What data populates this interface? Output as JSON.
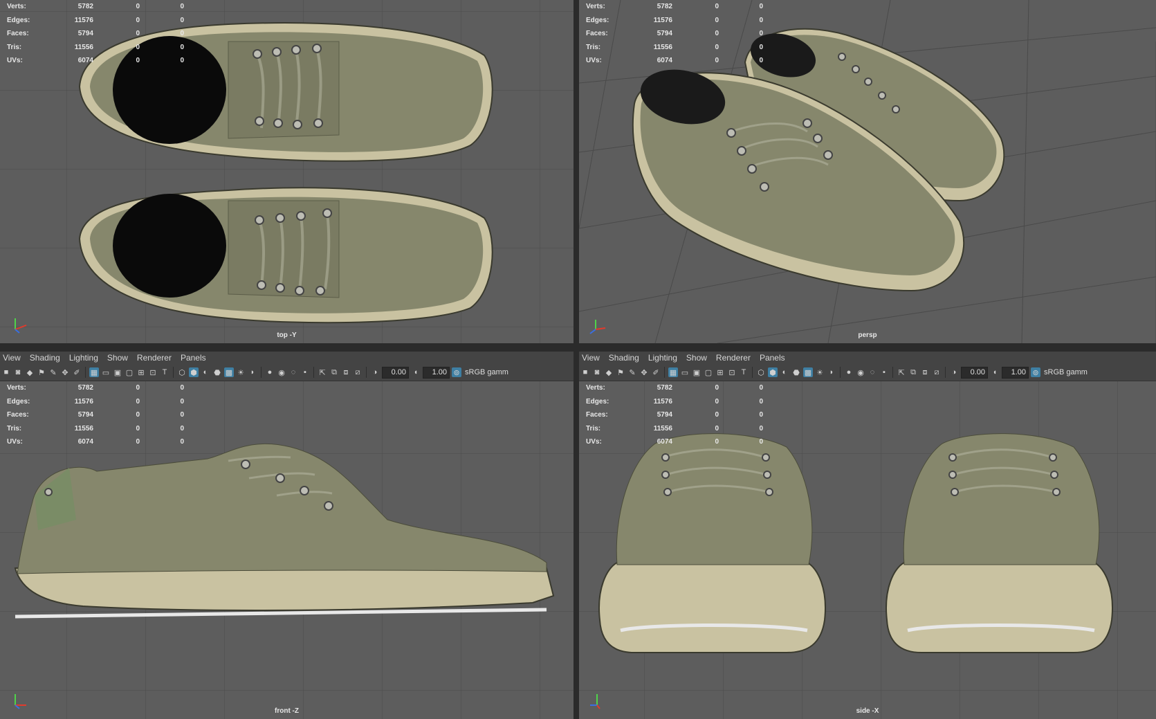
{
  "menu": [
    "View",
    "Shading",
    "Lighting",
    "Show",
    "Renderer",
    "Panels"
  ],
  "toolbar": {
    "exposure": "0.00",
    "gamma": "1.00",
    "colorspace": "sRGB gamm"
  },
  "hud": [
    {
      "label": "Verts:",
      "total": "5782",
      "selected": "0",
      "other": "0"
    },
    {
      "label": "Edges:",
      "total": "11576",
      "selected": "0",
      "other": "0"
    },
    {
      "label": "Faces:",
      "total": "5794",
      "selected": "0",
      "other": "0"
    },
    {
      "label": "Tris:",
      "total": "11556",
      "selected": "0",
      "other": "0"
    },
    {
      "label": "UVs:",
      "total": "6074",
      "selected": "0",
      "other": "0"
    }
  ],
  "panels": {
    "top": {
      "camera": "top -Y"
    },
    "persp": {
      "camera": "persp"
    },
    "front": {
      "camera": "front -Z"
    },
    "side": {
      "camera": "side -X"
    }
  },
  "axis_colors": {
    "x": "#e23a2c",
    "y": "#4fd34a",
    "z": "#3a6fe2"
  },
  "colors": {
    "viewport_bg": "#5d5d5d",
    "grid": "#4a4a4a",
    "shoe": "#86876c",
    "sole": "#c9c2a1"
  }
}
